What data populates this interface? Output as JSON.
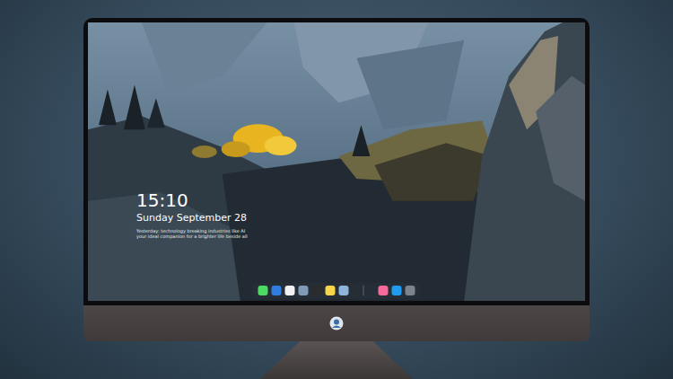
{
  "lock_screen": {
    "time": "15:10",
    "date": "Sunday September 28",
    "note_lines": [
      "Yesterday: technology breaking industries like AI",
      "your ideal companion for a brighter life beside all"
    ]
  },
  "dock": {
    "apps": [
      {
        "color": "#4cd964"
      },
      {
        "color": "#2f7de1"
      },
      {
        "color": "#eef0f2"
      },
      {
        "color": "#7f9bb8"
      },
      {
        "color": "#2b2b2b"
      },
      {
        "color": "#f7d54a"
      },
      {
        "color": "#8fb4d9"
      }
    ],
    "recent": [
      {
        "color": "#f56a9a"
      },
      {
        "color": "#1f9bf0"
      },
      {
        "color": "#7d838a"
      }
    ]
  }
}
